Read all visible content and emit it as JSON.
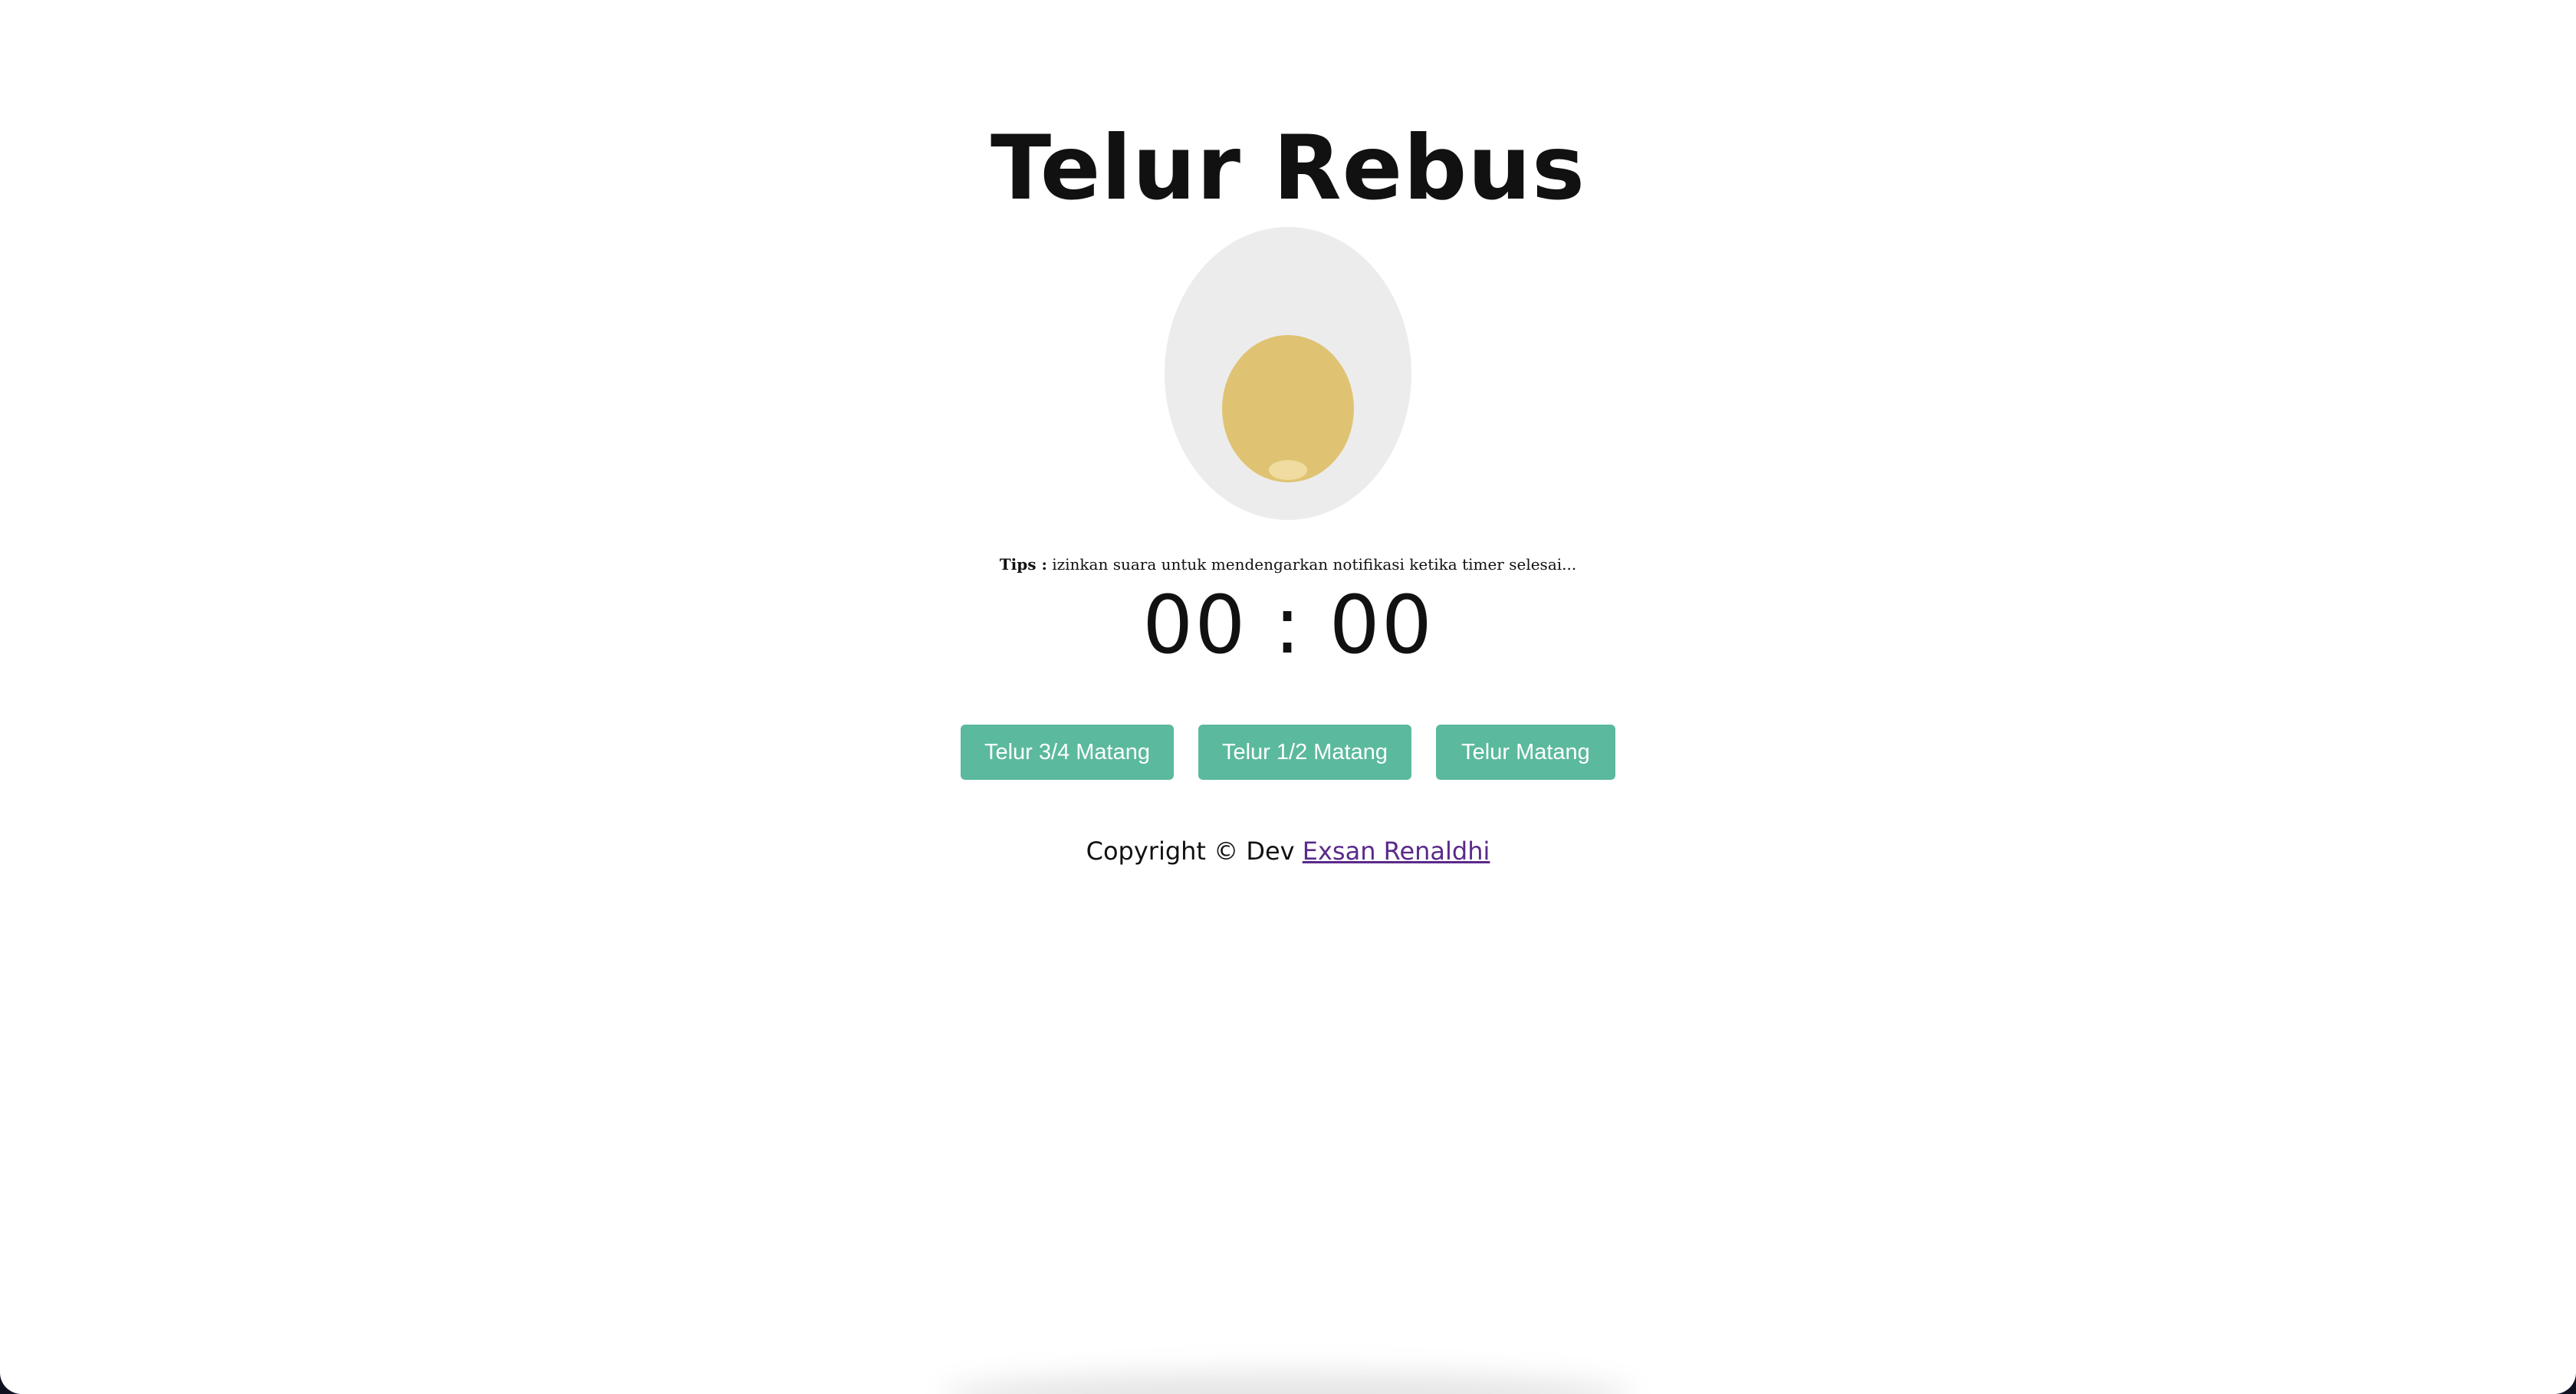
{
  "page": {
    "title": "Telur Rebus"
  },
  "tips": {
    "label": "Tips :",
    "text": "izinkan suara untuk mendengarkan notifikasi ketika timer selesai..."
  },
  "timer": {
    "minutes": "00",
    "separator": ":",
    "seconds": "00"
  },
  "buttons": [
    {
      "label": "Telur 3/4 Matang"
    },
    {
      "label": "Telur 1/2 Matang"
    },
    {
      "label": "Telur Matang"
    }
  ],
  "footer": {
    "text": "Copyright © Dev",
    "author_link": "Exsan Renaldhi"
  },
  "colors": {
    "button": "#5bb99d",
    "egg_white": "#ececec",
    "yolk": "#dfc373",
    "link": "#5a2a8a"
  }
}
